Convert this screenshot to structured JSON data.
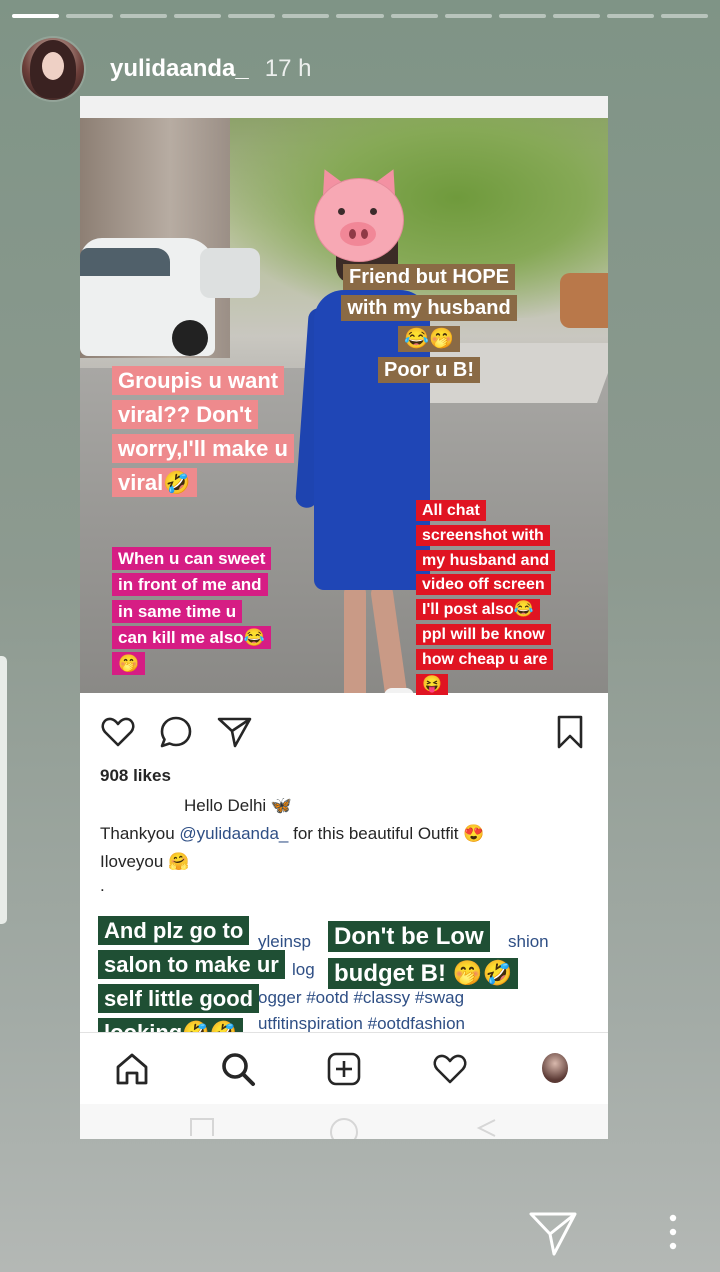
{
  "story": {
    "username": "yulidaanda_",
    "time": "17 h",
    "progress": {
      "total": 13,
      "current": 1
    }
  },
  "stickers": {
    "friend_hope": [
      "Friend but HOPE",
      "with my husband",
      "😂🤭",
      "Poor u B!"
    ],
    "groupis": [
      "Groupis u want",
      "viral?? Don't",
      "worry,I'll make u",
      "viral🤣"
    ],
    "sweet": [
      "When u can sweet",
      "in front of me and",
      "in same time u",
      "can kill me also😂",
      "🤭"
    ],
    "chat": [
      "All chat",
      "screenshot with",
      "my husband and",
      "video off screen",
      "I'll post also😂",
      "ppl will be know",
      "how cheap u are",
      "😝"
    ],
    "salon": [
      "And plz go to",
      "salon to make ur",
      "self little good",
      "looking🤣🤣"
    ],
    "low_budget": [
      "Don't be Low",
      "budget B! 🤭🤣"
    ]
  },
  "post": {
    "likes": "908 likes",
    "caption_line1": "Hello Delhi 🦋",
    "caption_thanks": "Thankyou",
    "caption_mention": "@yulidaanda_",
    "caption_rest": "for this beautiful Outfit 😍",
    "caption_line3": "Iloveyou 🤗",
    "caption_dot": ".",
    "hashtag_frag1": "yleinsp",
    "hashtag_frag2": "shion",
    "hashtag_frag3": "log",
    "hashtag_frag4": "ogger #ootd #classy #swag",
    "hashtag_frag5": "utfitinspiration #ootdfashion"
  },
  "icons": {
    "like": "heart-icon",
    "comment": "comment-icon",
    "share": "send-icon",
    "save": "bookmark-icon",
    "home": "home-icon",
    "search": "search-icon",
    "add": "add-icon",
    "activity": "heart-icon",
    "profile": "avatar"
  },
  "colors": {
    "brown_sticker": "#8a6a45",
    "pink_sticker": "#ee8a8d",
    "magenta_sticker": "#d61d84",
    "red_sticker": "#e01422",
    "green_sticker": "#1f4f34",
    "link": "#2f4f85"
  }
}
